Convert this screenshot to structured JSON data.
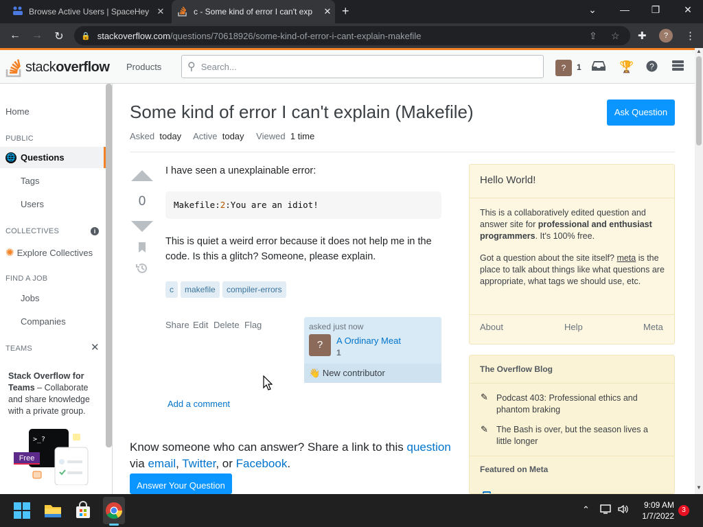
{
  "browser": {
    "tabs": [
      {
        "title": "Browse Active Users | SpaceHey",
        "active": false
      },
      {
        "title": "c - Some kind of error I can't exp",
        "active": true
      }
    ],
    "url_host": "stackoverflow.com",
    "url_path": "/questions/70618926/some-kind-of-error-i-cant-explain-makefile",
    "profile_initial": "?"
  },
  "so_header": {
    "logo_text_1": "stack",
    "logo_text_2": "overflow",
    "products": "Products",
    "search_placeholder": "Search...",
    "user_badge": "?",
    "reputation": "1"
  },
  "leftnav": {
    "home": "Home",
    "public": "PUBLIC",
    "questions": "Questions",
    "tags": "Tags",
    "users": "Users",
    "collectives": "COLLECTIVES",
    "explore_collectives": "Explore Collectives",
    "find_a_job": "FIND A JOB",
    "jobs": "Jobs",
    "companies": "Companies",
    "teams": "TEAMS",
    "teams_title_bold": "Stack Overflow for Teams",
    "teams_title_rest": " – Collaborate and share knowledge with a private group.",
    "free_badge": "Free"
  },
  "question": {
    "title": "Some kind of error I can't explain (Makefile)",
    "ask_button": "Ask Question",
    "asked_label": "Asked",
    "asked_value": "today",
    "active_label": "Active",
    "active_value": "today",
    "viewed_label": "Viewed",
    "viewed_value": "1 time",
    "votes": "0",
    "body_p1": "I have seen a unexplainable error:",
    "code_part1": "Makefile:",
    "code_num": "2",
    "code_part2": ":You are an idiot!",
    "body_p2": "This is quiet a weird error because it does not help me in the code. Is this a glitch? Someone, please explain.",
    "tags": [
      "c",
      "makefile",
      "compiler-errors"
    ],
    "share": "Share",
    "edit": "Edit",
    "delete": "Delete",
    "flag": "Flag",
    "asked_just_now": "asked just now",
    "user_name": "A Ordinary Meat",
    "user_rep": "1",
    "new_contributor": "New contributor",
    "add_comment": "Add a comment",
    "know_text_1": "Know someone who can answer? Share a link to this ",
    "know_link_question": "question",
    "know_text_2": " via ",
    "know_link_email": "email",
    "know_text_3": ", ",
    "know_link_twitter": "Twitter",
    "know_text_4": ", or ",
    "know_link_facebook": "Facebook",
    "know_text_5": ".",
    "answer_button": "Answer Your Question"
  },
  "sidebar": {
    "hello_title": "Hello World!",
    "hello_p1_a": "This is a collaboratively edited question and answer site for ",
    "hello_p1_bold": "professional and enthusiast programmers",
    "hello_p1_b": ". It's 100% free.",
    "hello_p2_a": "Got a question about the site itself? ",
    "hello_p2_link": "meta",
    "hello_p2_b": " is the place to talk about things like what questions are appropriate, what tags we should use, etc.",
    "about": "About",
    "help": "Help",
    "meta": "Meta",
    "blog_header": "The Overflow Blog",
    "blog_items": [
      "Podcast 403: Professional ethics and phantom braking",
      "The Bash is over, but the season lives a little longer"
    ],
    "featured_header": "Featured on Meta"
  },
  "taskbar": {
    "time": "9:09 AM",
    "date": "1/7/2022",
    "notifications": "3"
  },
  "colors": {
    "so_orange": "#f48225",
    "so_blue_button": "#0a95ff",
    "link_blue": "#0074cc",
    "tag_bg": "#e1ecf4",
    "sidebar_yellow": "#fdf7e2"
  }
}
